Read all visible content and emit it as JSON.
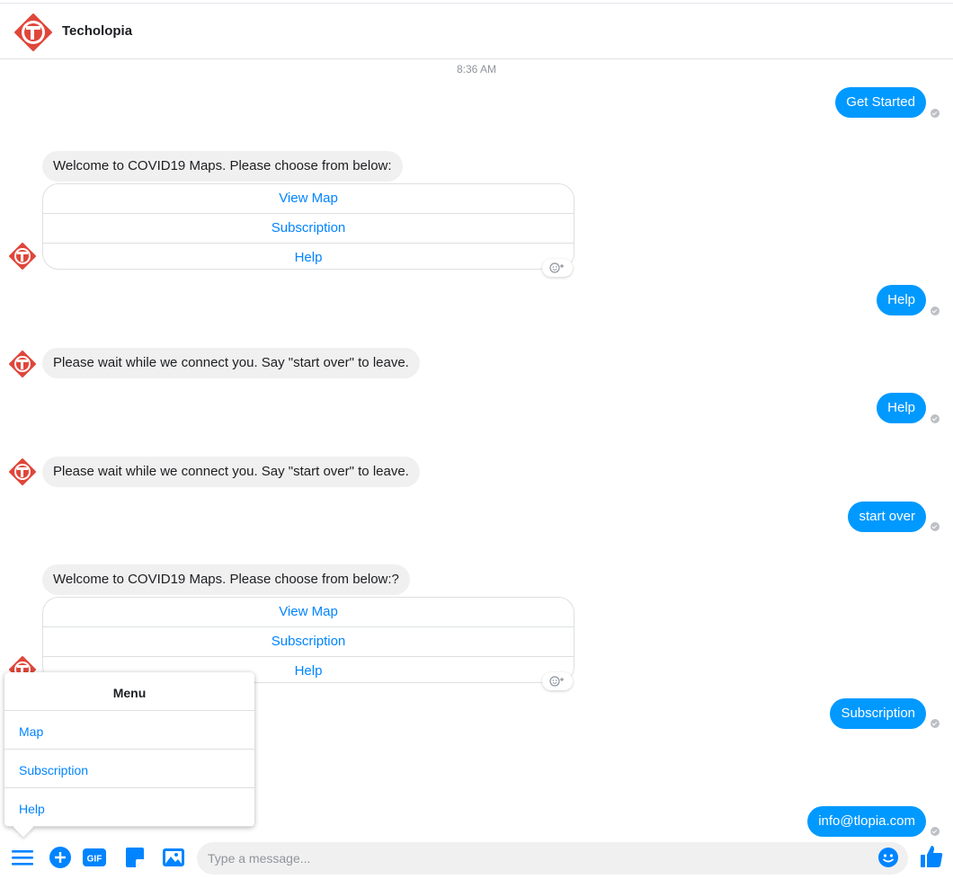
{
  "header": {
    "title": "Techolopia"
  },
  "timestamp": "8:36 AM",
  "messages": {
    "out1": "Get Started",
    "in1": "Welcome to COVID19 Maps. Please choose from below:",
    "card1": [
      "View Map",
      "Subscription",
      "Help"
    ],
    "out2": "Help",
    "in2": "Please wait while we connect you. Say \"start over\" to leave.",
    "out3": "Help",
    "in3": "Please wait while we connect you. Say \"start over\" to leave.",
    "out4": "start over",
    "in4": "Welcome to COVID19 Maps. Please choose from below:?",
    "card2": [
      "View Map",
      "Subscription",
      "Help"
    ],
    "out5": "Subscription",
    "out6": "info@tlopia.com"
  },
  "menu": {
    "title": "Menu",
    "items": [
      "Map",
      "Subscription",
      "Help"
    ]
  },
  "composer": {
    "placeholder": "Type a message...",
    "gif_label": "GIF"
  },
  "colors": {
    "brand": "#0099ff",
    "link": "#0084ff",
    "logo": "#e0463a"
  },
  "icons": [
    "hamburger-menu-icon",
    "plus-icon",
    "gif-icon",
    "sticker-icon",
    "image-icon",
    "emoji-icon",
    "thumbs-up-icon"
  ]
}
